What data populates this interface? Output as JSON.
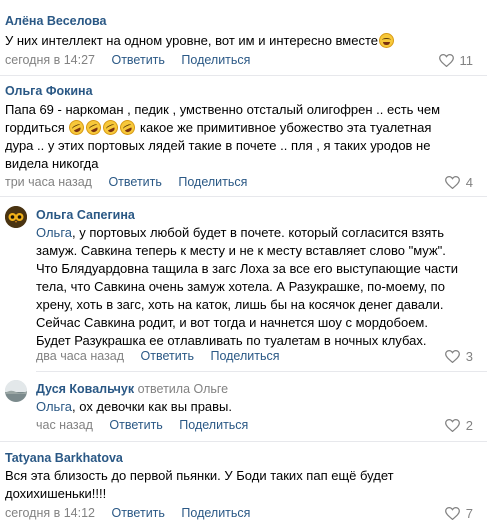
{
  "actions": {
    "reply": "Ответить",
    "share": "Поделиться"
  },
  "comments": [
    {
      "author": "Алёна Веселова",
      "lines": [
        "У них интеллект на одном уровне, вот им и интересно вместе"
      ],
      "time": "сегодня в 14:27",
      "likes": "11"
    },
    {
      "author": "Ольга Фокина",
      "lines": [
        "Папа 69 - наркоман , педик , умственно отсталый олигофрен .. есть чем",
        "гордиться",
        "какое же примитивное убожество эта туалетная",
        "дура .. у этих портовых лядей такие в почете .. пля , я таких уродов не",
        "видела никогда"
      ],
      "time": "три часа назад",
      "likes": "4"
    },
    {
      "author": "Ольга Сапегина",
      "reply_to": "Ольга",
      "lines": [
        ", у портовых любой будет в почете. который согласится взять",
        "замуж. Савкина теперь к месту и не к месту вставляет слово \"муж\".",
        "Что Блядуардовна тащила в загс Лоха за все его выступающие части",
        "тела, что Савкина очень замуж хотела. А Разукрашке, по-моему, по",
        "хрену, хоть в загс, хоть на каток, лишь бы на косячок денег давали.",
        "Сейчас Савкина родит, и вот тогда и начнется шоу с мордобоем.",
        "Будет Разукрашка ее отлавливать по туалетам в ночных клубах."
      ],
      "time": "два часа назад",
      "likes": "3"
    },
    {
      "author": "Дуся Ковальчук",
      "replied": "ответила Ольге",
      "reply_to": "Ольга",
      "lines": [
        ", ох девочки как вы правы."
      ],
      "time": "час назад",
      "likes": "2"
    },
    {
      "author": "Tatyana Barkhatova",
      "lines": [
        "Вся эта близость до первой пьянки. У Боди таких пап ещё будет",
        "дохихишеньки!!!!"
      ],
      "time": "сегодня в 14:12",
      "likes": "7"
    }
  ],
  "colors": {
    "link": "#2a5885",
    "meta": "#828282",
    "divider": "#e7e8ec"
  }
}
